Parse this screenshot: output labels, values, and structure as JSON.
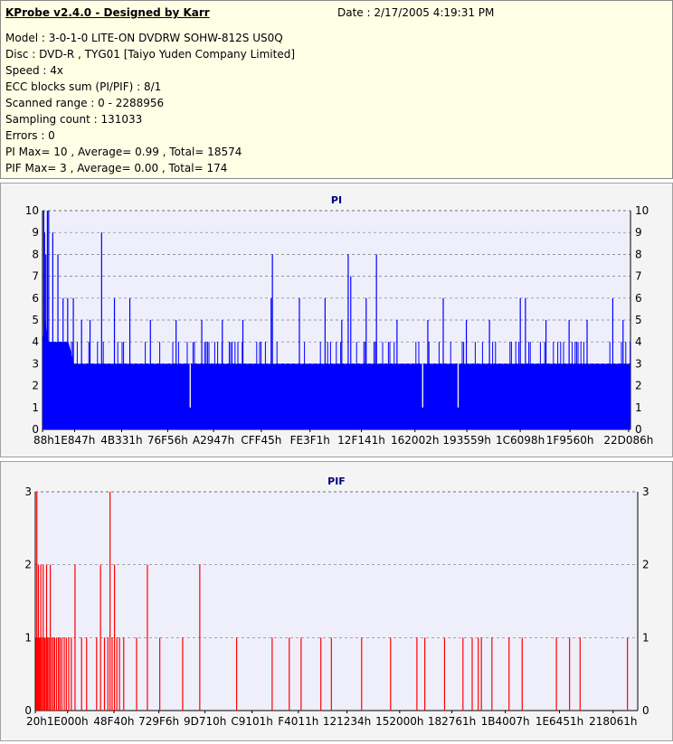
{
  "header": {
    "title": "KProbe v2.4.0 - Designed by Karr",
    "date": "Date : 2/17/2005 4:19:31 PM",
    "lines": [
      "Model : 3-0-1-0 LITE-ON DVDRW SOHW-812S  US0Q",
      "Disc : DVD-R , TYG01 [Taiyo Yuden Company Limited]",
      "Speed : 4x",
      "ECC blocks sum (PI/PIF) : 8/1",
      "Scanned range : 0 - 2288956",
      "Sampling count : 131033",
      "Errors : 0",
      "PI Max= 10 , Average= 0.99 , Total= 18574",
      "PIF Max= 3 , Average= 0.00 , Total= 174"
    ]
  },
  "colors": {
    "pi": "#0000ff",
    "pif": "#ff0000",
    "plot_bg": "#efeffc",
    "title": "#000080"
  },
  "chart_data": [
    {
      "type": "bar",
      "title": "PI",
      "xlabel": "",
      "ylabel": "",
      "ylim": [
        0,
        10
      ],
      "yticks": [
        0,
        1,
        2,
        3,
        4,
        5,
        6,
        7,
        8,
        9,
        10
      ],
      "grid": true,
      "x_tick_labels": [
        "88h",
        "1E847h",
        "4B331h",
        "76F56h",
        "A2947h",
        "CFF45h",
        "FE3F1h",
        "12F141h",
        "162002h",
        "193559h",
        "1C6098h",
        "1F9560h",
        "22D086h"
      ],
      "x_range": [
        0,
        2288956
      ],
      "x_ticks": [
        136,
        125000,
        308017,
        487254,
        665927,
        851781,
        1041393,
        1241409,
        1449986,
        1652057,
        1859736,
        2053472,
        2281606
      ],
      "series": [
        {
          "type": "profile",
          "values_note": "",
          "x": [
            0,
            11200,
            22400,
            33600,
            44800,
            56000,
            78400,
            100800,
            123200,
            145600,
            168000,
            190400,
            212800,
            235200,
            257600,
            280000,
            302400,
            324800,
            347200,
            369600,
            392000,
            414400,
            436800,
            459200,
            481600,
            504000,
            526400,
            548800,
            571200,
            593600,
            616000,
            638400,
            660800,
            683200,
            705600,
            728000,
            750400,
            772800,
            795200,
            817600,
            840000,
            862400,
            884800,
            907200,
            929600,
            952000,
            974400,
            996800,
            1019200,
            1041600,
            1064000,
            1086400,
            1108800,
            1131200,
            1153600,
            1176000,
            1198400,
            1220800,
            1243200,
            1265600,
            1288000,
            1310400,
            1332800,
            1355200,
            1377600,
            1400000,
            1422400,
            1444800,
            1467200,
            1489600,
            1512000,
            1534400,
            1556800,
            1579200,
            1601600,
            1624000,
            1646400,
            1668800,
            1691200,
            1713600,
            1736000,
            1758400,
            1780800,
            1803200,
            1825600,
            1848000,
            1870400,
            1892800,
            1915200,
            1937600,
            1960000,
            1982400,
            2004800,
            2027200,
            2049600,
            2072000,
            2094400,
            2116800,
            2139200,
            2161600,
            2184000,
            2206400,
            2228800,
            2251200,
            2273600,
            2288956
          ],
          "base": [
            4,
            5,
            4,
            4,
            4,
            4,
            4,
            4,
            3,
            3,
            3,
            3,
            3,
            3,
            3,
            3,
            3,
            3,
            3,
            3,
            3,
            3,
            3,
            3,
            3,
            3,
            3,
            3,
            3,
            3,
            3,
            3,
            3,
            3,
            3,
            3,
            3,
            3,
            3,
            3,
            3,
            3,
            3,
            3,
            3,
            3,
            3,
            3,
            3,
            3,
            3,
            3,
            3,
            3,
            3,
            3,
            3,
            3,
            3,
            3,
            3,
            3,
            3,
            3,
            3,
            3,
            3,
            3,
            3,
            3,
            3,
            3,
            3,
            3,
            3,
            3,
            3,
            3,
            3,
            3,
            3,
            3,
            3,
            3,
            3,
            3,
            3,
            3,
            3,
            3,
            3,
            3,
            3,
            3,
            3,
            3,
            3,
            3,
            3,
            3,
            3,
            3,
            3,
            3,
            3,
            3
          ],
          "spikes": [
            [
              5000,
              10
            ],
            [
              8000,
              9
            ],
            [
              13000,
              8
            ],
            [
              19000,
              10
            ],
            [
              24000,
              10
            ],
            [
              40000,
              9
            ],
            [
              60000,
              8
            ],
            [
              80000,
              6
            ],
            [
              98000,
              6
            ],
            [
              120000,
              6
            ],
            [
              152000,
              5
            ],
            [
              185000,
              5
            ],
            [
              230000,
              9
            ],
            [
              280000,
              6
            ],
            [
              340000,
              6
            ],
            [
              420000,
              5
            ],
            [
              520000,
              5
            ],
            [
              620000,
              5
            ],
            [
              700000,
              5
            ],
            [
              780000,
              5
            ],
            [
              890000,
              6
            ],
            [
              895000,
              8
            ],
            [
              1000000,
              6
            ],
            [
              1100000,
              6
            ],
            [
              1165000,
              5
            ],
            [
              1190000,
              8
            ],
            [
              1200000,
              7
            ],
            [
              1260000,
              6
            ],
            [
              1300000,
              8
            ],
            [
              1380000,
              5
            ],
            [
              1500000,
              5
            ],
            [
              1560000,
              6
            ],
            [
              1650000,
              5
            ],
            [
              1740000,
              5
            ],
            [
              1860000,
              6
            ],
            [
              1880000,
              6
            ],
            [
              1960000,
              5
            ],
            [
              2050000,
              5
            ],
            [
              2120000,
              5
            ],
            [
              2220000,
              6
            ],
            [
              2260000,
              5
            ]
          ],
          "dips": [
            [
              575000,
              1
            ],
            [
              1480000,
              1
            ],
            [
              1618000,
              1
            ]
          ]
        }
      ]
    },
    {
      "type": "bar",
      "title": "PIF",
      "xlabel": "",
      "ylabel": "",
      "ylim": [
        0,
        3
      ],
      "yticks": [
        0,
        1,
        2,
        3
      ],
      "grid": true,
      "x_tick_labels": [
        "20h",
        "1E000h",
        "48F40h",
        "729F6h",
        "9D710h",
        "C9101h",
        "F4011h",
        "121234h",
        "152000h",
        "182761h",
        "1B4007h",
        "1E6451h",
        "218061h"
      ],
      "x_range": [
        0,
        2288956
      ],
      "x_ticks": [
        32,
        122880,
        298816,
        469494,
        644880,
        823553,
        999441,
        1184308,
        1384448,
        1582945,
        1785863,
        1991761,
        2195553
      ],
      "series": [
        {
          "name": "",
          "x": [
            3000,
            6000,
            9000,
            12000,
            15000,
            18000,
            21000,
            25000,
            30000,
            34000,
            38000,
            43000,
            47000,
            52000,
            57000,
            63000,
            69000,
            74000,
            81000,
            88000,
            94000,
            101000,
            110000,
            118000,
            127000,
            137000,
            151000,
            176000,
            195000,
            233000,
            248000,
            263000,
            276000,
            284000,
            292000,
            301000,
            310000,
            320000,
            336000,
            385000,
            426000,
            473000,
            560000,
            625000,
            765000,
            900000,
            965000,
            1010000,
            1085000,
            1125000,
            1240000,
            1350000,
            1450000,
            1480000,
            1555000,
            1625000,
            1660000,
            1683000,
            1695000,
            1735000,
            1800000,
            1850000,
            1980000,
            2030000,
            2070000,
            2250000
          ],
          "values": [
            1,
            3,
            1,
            2,
            1,
            1,
            2,
            1,
            2,
            1,
            1,
            2,
            1,
            1,
            2,
            1,
            1,
            1,
            1,
            1,
            1,
            1,
            1,
            1,
            1,
            1,
            2,
            1,
            1,
            1,
            2,
            1,
            1,
            3,
            1,
            2,
            1,
            1,
            1,
            1,
            2,
            1,
            1,
            2,
            1,
            1,
            1,
            1,
            1,
            1,
            1,
            1,
            1,
            1,
            1,
            1,
            1,
            1,
            1,
            1,
            1,
            1,
            1,
            1,
            1,
            1
          ]
        }
      ]
    }
  ]
}
